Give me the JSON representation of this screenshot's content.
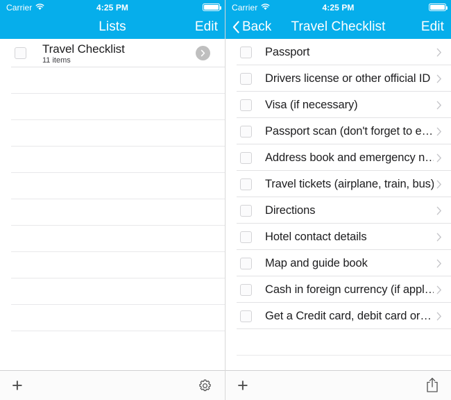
{
  "theme": {
    "accent_blue": "#06AEEB",
    "separator": "#E2E2E4",
    "text_primary": "#1C1C1E",
    "chevron_gray": "#C4C4C8",
    "checkbox_border": "#D3D3D6",
    "toolbar_bg": "#FBFBFB"
  },
  "left_screen": {
    "status_bar": {
      "carrier": "Carrier",
      "wifi_icon": "wifi-icon",
      "time": "4:25 PM",
      "battery_icon": "battery-full-icon"
    },
    "nav_bar": {
      "title": "Lists",
      "edit_label": "Edit"
    },
    "list": {
      "items": [
        {
          "title": "Travel Checklist",
          "subtitle": "11 items",
          "checkbox": "unchecked",
          "disclosure_icon": "chevron-right-circle-icon"
        }
      ],
      "empty_row_count": 11
    },
    "toolbar": {
      "add_label": "+",
      "add_icon": "plus-icon",
      "settings_icon": "gear-icon"
    }
  },
  "right_screen": {
    "status_bar": {
      "carrier": "Carrier",
      "wifi_icon": "wifi-icon",
      "time": "4:25 PM",
      "battery_icon": "battery-full-icon"
    },
    "nav_bar": {
      "back_label": "Back",
      "back_icon": "chevron-left-icon",
      "title": "Travel Checklist",
      "edit_label": "Edit"
    },
    "checklist": {
      "items": [
        {
          "label": "Passport",
          "checkbox": "unchecked",
          "chevron": "chevron-right-icon"
        },
        {
          "label": "Drivers license or other official ID",
          "checkbox": "unchecked",
          "chevron": "chevron-right-icon"
        },
        {
          "label": "Visa (if necessary)",
          "checkbox": "unchecked",
          "chevron": "chevron-right-icon"
        },
        {
          "label": "Passport scan (don't forget to e…",
          "checkbox": "unchecked",
          "chevron": "chevron-right-icon"
        },
        {
          "label": "Address book and emergency n…",
          "checkbox": "unchecked",
          "chevron": "chevron-right-icon"
        },
        {
          "label": "Travel tickets (airplane, train, bus)",
          "checkbox": "unchecked",
          "chevron": "chevron-right-icon"
        },
        {
          "label": "Directions",
          "checkbox": "unchecked",
          "chevron": "chevron-right-icon"
        },
        {
          "label": "Hotel contact details",
          "checkbox": "unchecked",
          "chevron": "chevron-right-icon"
        },
        {
          "label": "Map and guide book",
          "checkbox": "unchecked",
          "chevron": "chevron-right-icon"
        },
        {
          "label": "Cash in foreign currency (if appl…",
          "checkbox": "unchecked",
          "chevron": "chevron-right-icon"
        },
        {
          "label": "Get a Credit card, debit card or…",
          "checkbox": "unchecked",
          "chevron": "chevron-right-icon"
        }
      ]
    },
    "toolbar": {
      "add_label": "+",
      "add_icon": "plus-icon",
      "share_icon": "share-icon"
    }
  }
}
